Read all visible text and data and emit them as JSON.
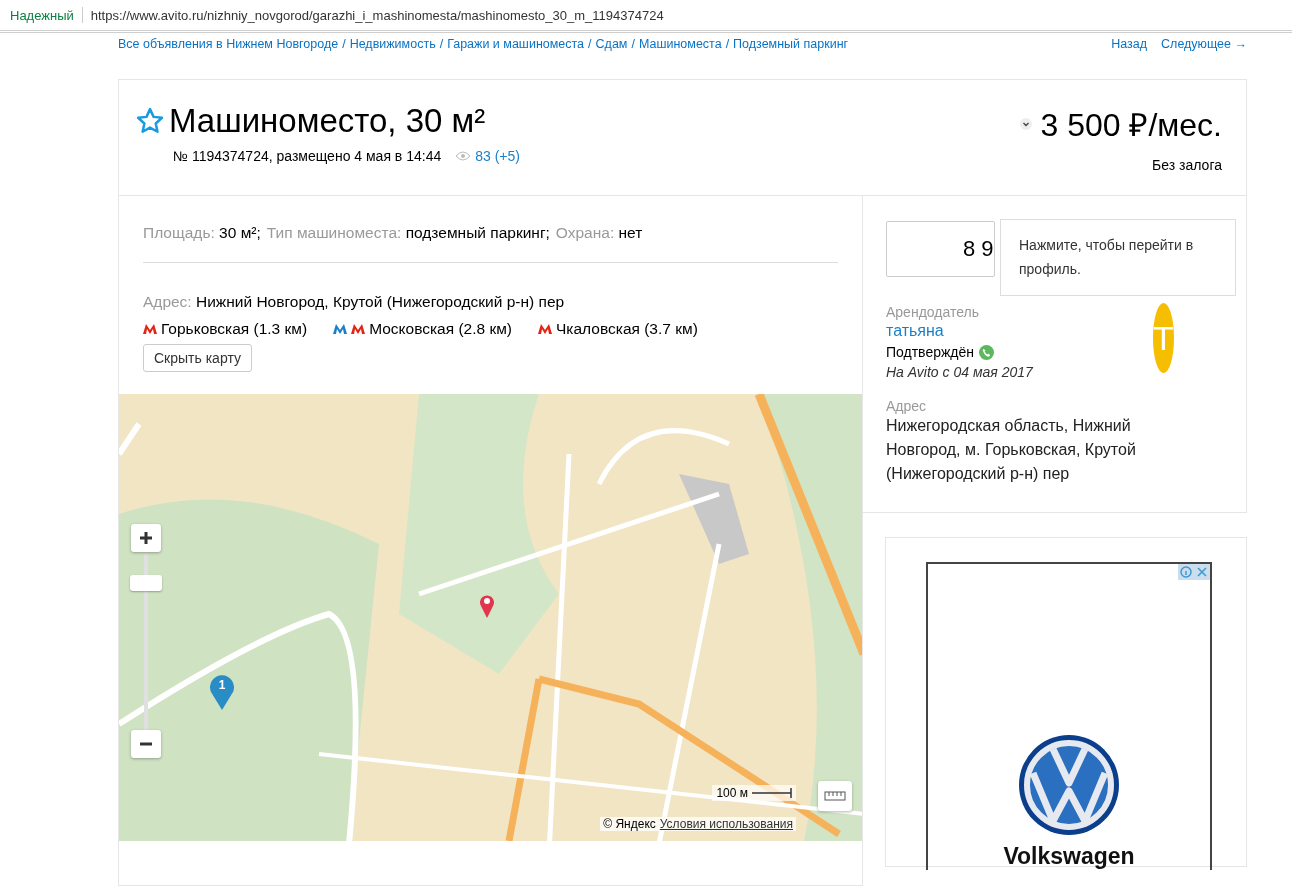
{
  "browser": {
    "security": "Надежный",
    "url": "https://www.avito.ru/nizhniy_novgorod/garazhi_i_mashinomesta/mashinomesto_30_m_1194374724"
  },
  "breadcrumbs": [
    {
      "label": "Все объявления в Нижнем Новгороде",
      "separator": "/"
    },
    {
      "label": "Недвижимость",
      "separator": "/"
    },
    {
      "label": "Гаражи и машиноместа",
      "separator": "/"
    },
    {
      "label": "Сдам",
      "separator": "/"
    },
    {
      "label": "Машиноместа",
      "separator": "/"
    },
    {
      "label": "Подземный паркинг"
    }
  ],
  "nav": [
    "Назад",
    "Следующее →"
  ],
  "listing": {
    "favorite": false,
    "title": "Машиноместо, 30 м²",
    "meta": "№ 1194374724, размещено 4 мая в 14:44",
    "views": "83 (+5)",
    "price": "3 500 ₽/мес.",
    "deposit": "Без залога"
  },
  "params": [
    {
      "label": "Площадь:",
      "value": "30 м²;"
    },
    {
      "label": "Тип машиноместа:",
      "value": "подземный паркинг;"
    },
    {
      "label": "Охрана:",
      "value": "нет"
    }
  ],
  "address": {
    "label": "Адрес:",
    "value": "Нижний Новгород, Крутой (Нижегородский р-н) пер"
  },
  "metro": [
    {
      "name": "Горьковская (1.3 км)",
      "lines": [
        {
          "color": "#e42313"
        }
      ]
    },
    {
      "name": "Московская (2.8 км)",
      "lines": [
        {
          "color": "#1a7fc9"
        },
        {
          "color": "#e42313"
        }
      ]
    },
    {
      "name": "Чкаловская (3.7 км)",
      "lines": [
        {
          "color": "#e42313"
        }
      ]
    }
  ],
  "map_toggle": "Скрыть карту",
  "map": {
    "kind": "picture",
    "marker_label": "1",
    "scale": "100 м",
    "copyright": "© Яндекс",
    "terms": "Условия использования"
  },
  "seller": {
    "phone": "8 9",
    "tooltip": "Нажмите, чтобы перейти в профиль.",
    "role": "Арендодатель",
    "name": "татьяна",
    "verified": "Подтверждён",
    "since": "На Avito с 04 мая 2017",
    "avatar": "Т",
    "address_label": "Адрес",
    "address": "Нижегородская область, Нижний Новгород, м. Горьковская, Крутой (Нижегородский р-н) пер"
  },
  "ad": {
    "brand": "Volkswagen"
  }
}
